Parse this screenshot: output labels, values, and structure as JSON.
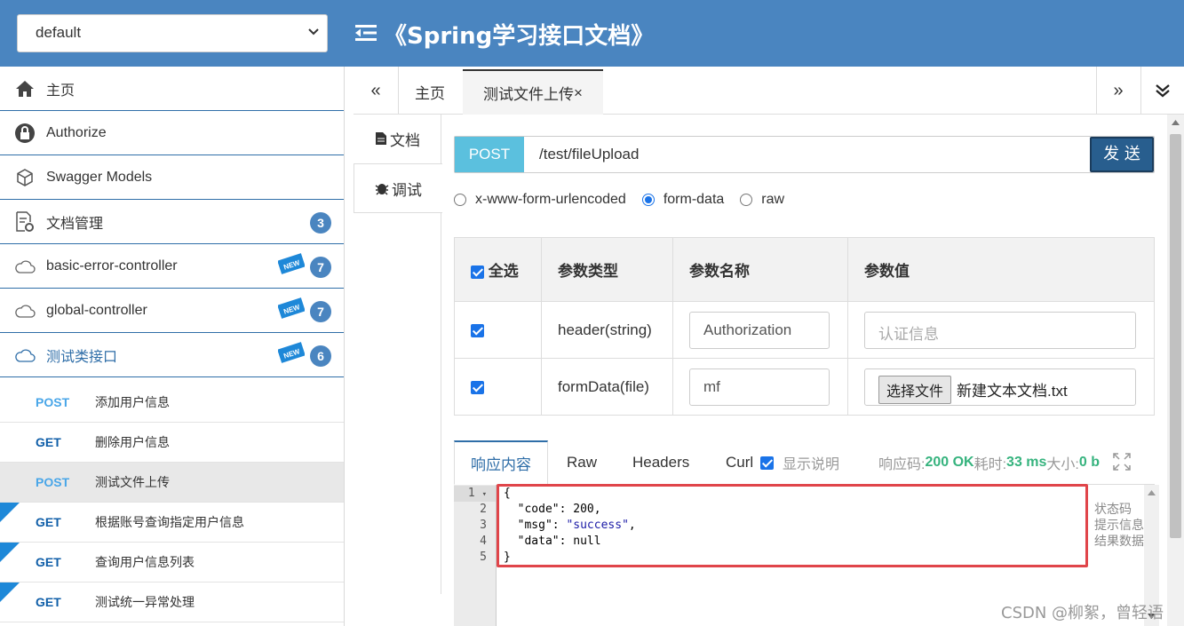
{
  "header": {
    "group_selected": "default",
    "title": "《Spring学习接口文档》"
  },
  "sidebar": {
    "items": [
      {
        "label": "主页",
        "icon": "home-icon"
      },
      {
        "label": "Authorize",
        "icon": "lock-icon"
      },
      {
        "label": "Swagger Models",
        "icon": "cube-icon"
      },
      {
        "label": "文档管理",
        "icon": "doc-settings-icon",
        "badge": "3"
      },
      {
        "label": "basic-error-controller",
        "icon": "api-cloud-icon",
        "badge": "7",
        "new": true
      },
      {
        "label": "global-controller",
        "icon": "api-cloud-icon",
        "badge": "7",
        "new": true
      },
      {
        "label": "测试类接口",
        "icon": "api-cloud-icon",
        "badge": "6",
        "new": true
      }
    ],
    "apis": [
      {
        "method": "POST",
        "label": "添加用户信息"
      },
      {
        "method": "GET",
        "label": "删除用户信息"
      },
      {
        "method": "POST",
        "label": "测试文件上传"
      },
      {
        "method": "GET",
        "label": "根据账号查询指定用户信息"
      },
      {
        "method": "GET",
        "label": "查询用户信息列表"
      },
      {
        "method": "GET",
        "label": "测试统一异常处理"
      }
    ],
    "new_tag": "NEW"
  },
  "tabs": {
    "prev": "«",
    "home": "主页",
    "current": "测试文件上传",
    "close": "×",
    "next": "»",
    "more": "⌄"
  },
  "doc_tabs": {
    "doc": "文档",
    "debug": "调试"
  },
  "request": {
    "method": "POST",
    "url": "/test/fileUpload",
    "send": "发 送",
    "content_types": [
      "x-www-form-urlencoded",
      "form-data",
      "raw"
    ]
  },
  "params": {
    "headers": [
      "全选",
      "参数类型",
      "参数名称",
      "参数值"
    ],
    "rows": [
      {
        "type": "header(string)",
        "name": "Authorization",
        "value_placeholder": "认证信息"
      },
      {
        "type": "formData(file)",
        "name": "mf",
        "file_button": "选择文件",
        "file_name": "新建文本文档.txt"
      }
    ]
  },
  "response": {
    "tabs": [
      "响应内容",
      "Raw",
      "Headers",
      "Curl"
    ],
    "show_desc": "显示说明",
    "code_label": "响应码:",
    "code_value": "200 OK",
    "time_label": "耗时:",
    "time_value": "33 ms",
    "size_label": "大小:",
    "size_value": "0 b",
    "lines": [
      "1",
      "2",
      "3",
      "4",
      "5"
    ],
    "notes": [
      "状态码",
      "提示信息",
      "结果数据"
    ]
  },
  "watermark": "CSDN @柳絮，曾轻语"
}
